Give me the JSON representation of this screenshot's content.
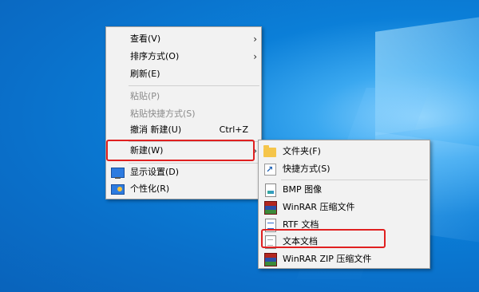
{
  "main_menu": {
    "items": [
      {
        "label": "查看(V)",
        "has_arrow": true
      },
      {
        "label": "排序方式(O)",
        "has_arrow": true
      },
      {
        "label": "刷新(E)"
      },
      {
        "label": "粘贴(P)",
        "disabled": true
      },
      {
        "label": "粘贴快捷方式(S)",
        "disabled": true
      },
      {
        "label": "撤消 新建(U)",
        "shortcut": "Ctrl+Z"
      },
      {
        "label": "新建(W)",
        "has_arrow": true,
        "highlighted": true
      },
      {
        "label": "显示设置(D)",
        "icon": "display-icon"
      },
      {
        "label": "个性化(R)",
        "icon": "personalize-icon"
      }
    ],
    "arrow_glyph": "›"
  },
  "sub_menu": {
    "items": [
      {
        "label": "文件夹(F)",
        "icon": "folder-icon"
      },
      {
        "label": "快捷方式(S)",
        "icon": "shortcut-icon"
      },
      {
        "label": "BMP 图像",
        "icon": "bmp-image-icon"
      },
      {
        "label": "WinRAR 压缩文件",
        "icon": "winrar-icon"
      },
      {
        "label": "RTF 文档",
        "icon": "rtf-document-icon"
      },
      {
        "label": "文本文档",
        "icon": "text-document-icon",
        "highlighted": true
      },
      {
        "label": "WinRAR ZIP 压缩文件",
        "icon": "winrar-zip-icon"
      }
    ]
  },
  "colors": {
    "highlight_border": "#e02020",
    "menu_background": "#f2f2f2",
    "desktop": "#0b7fd8"
  }
}
